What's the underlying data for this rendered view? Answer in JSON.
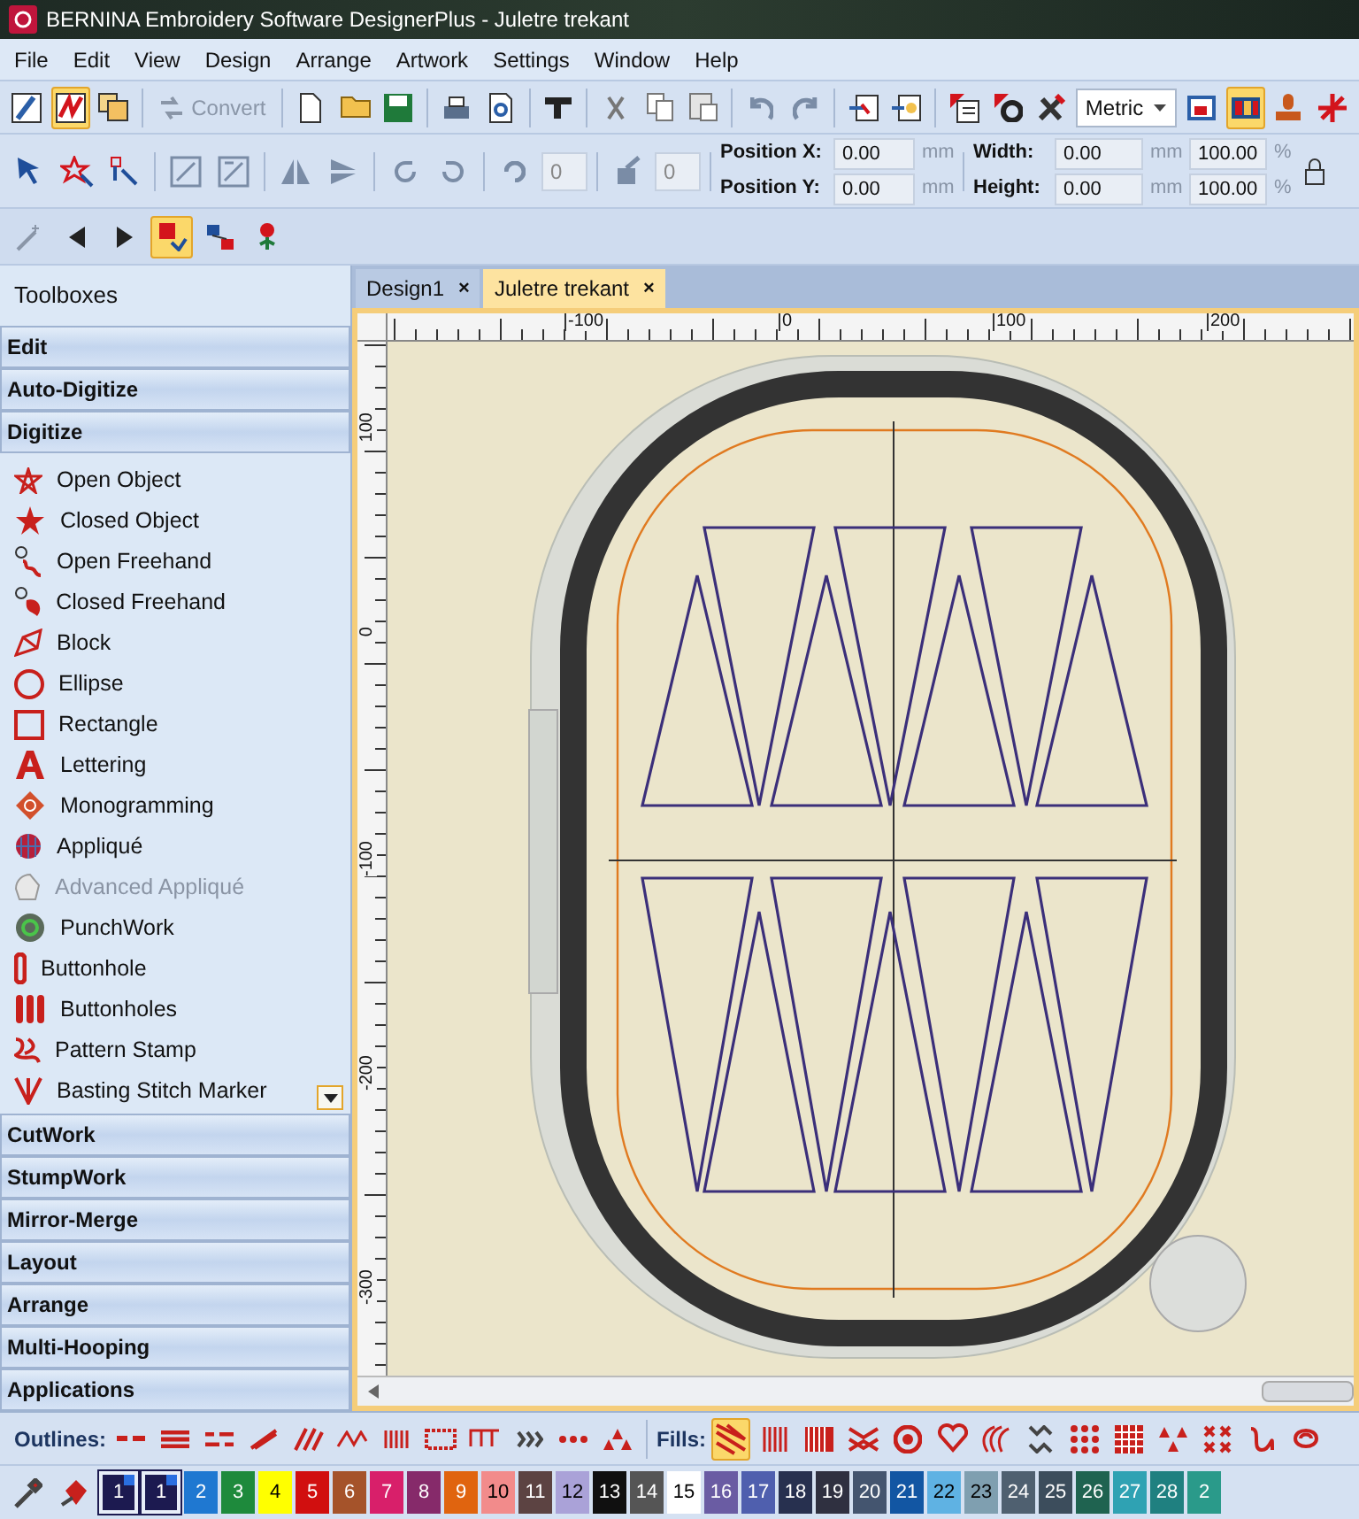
{
  "title_bar": {
    "title": "BERNINA Embroidery Software DesignerPlus - Juletre trekant"
  },
  "menu_bar": [
    "File",
    "Edit",
    "View",
    "Design",
    "Arrange",
    "Artwork",
    "Settings",
    "Window",
    "Help"
  ],
  "toolbar_1": {
    "view_modes": [
      {
        "selected": false
      },
      {
        "selected": true
      },
      {
        "selected": false
      }
    ],
    "convert_button": {
      "label": "Convert",
      "disabled": true
    },
    "units_dropdown": "Metric",
    "display_toggles": [
      {
        "selected": false
      },
      {
        "selected": true
      }
    ]
  },
  "toolbar_2": {
    "rotate_value": "0",
    "skew_value": "0",
    "position_x": {
      "label": "Position X:",
      "value": "0.00",
      "unit": "mm"
    },
    "position_y": {
      "label": "Position Y:",
      "value": "0.00",
      "unit": "mm"
    },
    "width": {
      "label": "Width:",
      "value": "0.00",
      "unit": "mm",
      "percent": "100.00",
      "percent_unit": "%"
    },
    "height": {
      "label": "Height:",
      "value": "0.00",
      "unit": "mm",
      "percent": "100.00",
      "percent_unit": "%"
    }
  },
  "toolbar_3": {
    "modes": [
      {
        "selected": true
      },
      {
        "selected": false
      },
      {
        "selected": false
      }
    ]
  },
  "toolboxes": {
    "title": "Toolboxes",
    "sections_above": [
      "Edit",
      "Auto-Digitize",
      "Digitize"
    ],
    "tools": [
      {
        "label": "Open Object",
        "disabled": false
      },
      {
        "label": "Closed Object",
        "disabled": false
      },
      {
        "label": "Open Freehand",
        "disabled": false
      },
      {
        "label": "Closed Freehand",
        "disabled": false
      },
      {
        "label": "Block",
        "disabled": false
      },
      {
        "label": "Ellipse",
        "disabled": false
      },
      {
        "label": "Rectangle",
        "disabled": false
      },
      {
        "label": "Lettering",
        "disabled": false
      },
      {
        "label": "Monogramming",
        "disabled": false
      },
      {
        "label": "Appliqué",
        "disabled": false
      },
      {
        "label": "Advanced Appliqué",
        "disabled": true
      },
      {
        "label": "PunchWork",
        "disabled": false
      },
      {
        "label": "Buttonhole",
        "disabled": false
      },
      {
        "label": "Buttonholes",
        "disabled": false
      },
      {
        "label": "Pattern Stamp",
        "disabled": false
      },
      {
        "label": "Basting Stitch Marker",
        "disabled": false
      }
    ],
    "sections_below": [
      "CutWork",
      "StumpWork",
      "Mirror-Merge",
      "Layout",
      "Arrange",
      "Multi-Hooping",
      "Applications"
    ]
  },
  "tabs": [
    {
      "label": "Design1",
      "close": "×",
      "selected": false
    },
    {
      "label": "Juletre trekant",
      "close": "×",
      "selected": true
    }
  ],
  "rulers": {
    "horizontal_labels": [
      "-100",
      "0",
      "100",
      "200"
    ],
    "vertical_labels": [
      "100",
      "0",
      "-100",
      "-200",
      "-300"
    ]
  },
  "bottom_toolbar": {
    "outlines_label": "Outlines:",
    "fills_label": "Fills:",
    "fill_styles": [
      {
        "selected": true
      },
      {
        "selected": false
      },
      {
        "selected": false
      },
      {
        "selected": false
      },
      {
        "selected": false
      },
      {
        "selected": false
      },
      {
        "selected": false
      },
      {
        "selected": false
      },
      {
        "selected": false
      },
      {
        "selected": false
      },
      {
        "selected": false
      },
      {
        "selected": false
      },
      {
        "selected": false
      },
      {
        "selected": false
      }
    ]
  },
  "color_palette": [
    {
      "label": "1",
      "color": "#1c1a50",
      "current": true
    },
    {
      "label": "1",
      "color": "#1c1a50",
      "current": true
    },
    {
      "label": "2",
      "color": "#1f78d1",
      "current": false
    },
    {
      "label": "3",
      "color": "#1e8a3c",
      "current": false
    },
    {
      "label": "4",
      "color": "#ffff00",
      "current": false
    },
    {
      "label": "5",
      "color": "#d10f0f",
      "current": false
    },
    {
      "label": "6",
      "color": "#a5532a",
      "current": false
    },
    {
      "label": "7",
      "color": "#d81f6a",
      "current": false
    },
    {
      "label": "8",
      "color": "#862a6a",
      "current": false
    },
    {
      "label": "9",
      "color": "#e0640f",
      "current": false
    },
    {
      "label": "10",
      "color": "#f28b8b",
      "current": false
    },
    {
      "label": "11",
      "color": "#5c4342",
      "current": false
    },
    {
      "label": "12",
      "color": "#aaa2d8",
      "current": false
    },
    {
      "label": "13",
      "color": "#101010",
      "current": false
    },
    {
      "label": "14",
      "color": "#555555",
      "current": false
    },
    {
      "label": "15",
      "color": "#ffffff",
      "current": false
    },
    {
      "label": "16",
      "color": "#6a5ca3",
      "current": false
    },
    {
      "label": "17",
      "color": "#4f5fae",
      "current": false
    },
    {
      "label": "18",
      "color": "#27304f",
      "current": false
    },
    {
      "label": "19",
      "color": "#2f3040",
      "current": false
    },
    {
      "label": "20",
      "color": "#44556f",
      "current": false
    },
    {
      "label": "21",
      "color": "#1256a3",
      "current": false
    },
    {
      "label": "22",
      "color": "#5fb2e3",
      "current": false
    },
    {
      "label": "23",
      "color": "#7f9fb0",
      "current": false
    },
    {
      "label": "24",
      "color": "#4f6070",
      "current": false
    },
    {
      "label": "25",
      "color": "#3c4d5c",
      "current": false
    },
    {
      "label": "26",
      "color": "#1f6350",
      "current": false
    },
    {
      "label": "27",
      "color": "#2fa2b3",
      "current": false
    },
    {
      "label": "28",
      "color": "#1f8080",
      "current": false
    },
    {
      "label": "2",
      "color": "#2a9a8a",
      "current": false
    }
  ]
}
